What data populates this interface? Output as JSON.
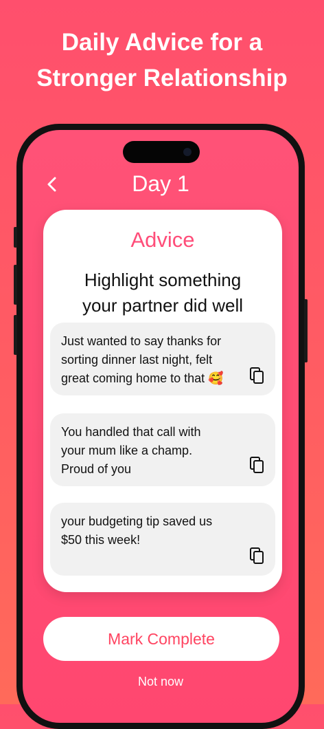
{
  "promo": {
    "headline_line1": "Daily Advice for a",
    "headline_line2": "Stronger Relationship"
  },
  "header": {
    "back_icon": "chevron-left-icon",
    "title": "Day 1"
  },
  "card": {
    "label": "Advice",
    "heading_line1": "Highlight something",
    "heading_line2": "your partner did well",
    "messages": [
      {
        "lines": [
          "Just wanted to say thanks for",
          "sorting dinner last night, felt",
          "great coming home to that 🥰"
        ],
        "copy_icon": "copy-icon"
      },
      {
        "lines": [
          "You handled that call with",
          "your mum like a champ.",
          "Proud of you"
        ],
        "copy_icon": "copy-icon"
      },
      {
        "lines": [
          "your budgeting tip saved us",
          "$50 this week!"
        ],
        "copy_icon": "copy-icon"
      }
    ]
  },
  "actions": {
    "primary_label": "Mark Complete",
    "secondary_label": "Not now"
  },
  "colors": {
    "background": "#ff5667",
    "screen": "#ff4b73",
    "accent_text": "#ff4d79",
    "card": "#ffffff",
    "message_bg": "#f1f1f1"
  }
}
